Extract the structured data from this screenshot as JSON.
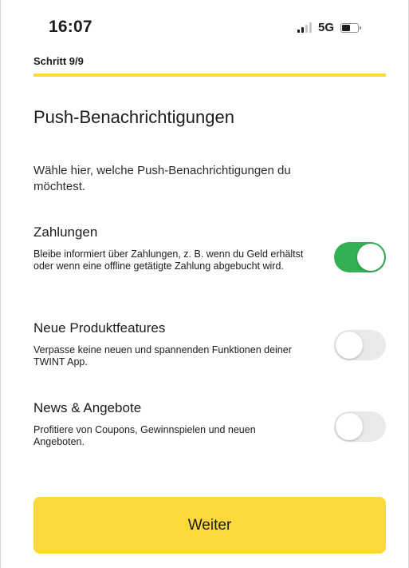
{
  "status_bar": {
    "time": "16:07",
    "network": "5G",
    "signal_bars_active": 2,
    "signal_bars_total": 4,
    "battery_level": 0.6
  },
  "step": {
    "label": "Schritt 9/9",
    "progress": 1.0
  },
  "page": {
    "title": "Push-Benachrichtigungen",
    "intro": "Wähle hier, welche Push-Benachrichtigungen du möchtest."
  },
  "settings": [
    {
      "title": "Zahlungen",
      "description": "Bleibe informiert über Zahlungen, z. B. wenn du Geld erhältst oder wenn eine offline getätigte Zahlung abgebucht wird.",
      "enabled": true
    },
    {
      "title": "Neue Produktfeatures",
      "description": "Verpasse keine neuen und spannenden Funktionen deiner TWINT App.",
      "enabled": false
    },
    {
      "title": "News & Angebote",
      "description": "Profitiere von Coupons, Gewinnspielen und neuen Angeboten.",
      "enabled": false
    }
  ],
  "actions": {
    "continue_label": "Weiter"
  },
  "colors": {
    "accent_yellow": "#fbd93a",
    "toggle_on": "#31b054",
    "toggle_off": "#e9e9eb"
  },
  "icons": {
    "signal": "cellular-signal-icon",
    "battery": "battery-icon"
  }
}
